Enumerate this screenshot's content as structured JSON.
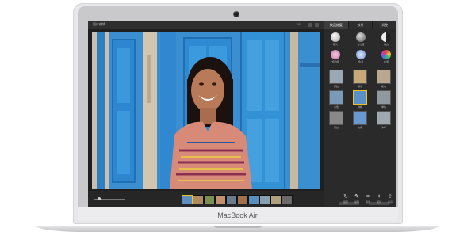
{
  "device": {
    "brand_label": "MacBook Air"
  },
  "app": {
    "window_title": "照片编辑",
    "photo_counter": "1/8",
    "panel_tabs": [
      {
        "label": "快速修复",
        "active": true
      },
      {
        "label": "效果",
        "active": false
      },
      {
        "label": "调整",
        "active": false
      }
    ]
  },
  "adjustments": [
    {
      "label": "曝光",
      "icon": "exposure-icon",
      "color": "#e5e5e5"
    },
    {
      "label": "对比度",
      "icon": "contrast-icon",
      "color": "#9a9a9a"
    },
    {
      "label": "黑白",
      "icon": "bw-icon",
      "color": "#333333"
    },
    {
      "label": "饱和度",
      "icon": "saturation-icon",
      "color": "#c06aa0"
    },
    {
      "label": "色温",
      "icon": "temperature-icon",
      "color": "#6a8fd0"
    },
    {
      "label": "色调",
      "icon": "tint-icon",
      "color": "#e08a40"
    }
  ],
  "filters": [
    {
      "label": "原始",
      "selected": false
    },
    {
      "label": "褪色",
      "selected": false
    },
    {
      "label": "暖色",
      "selected": false
    },
    {
      "label": "冷色",
      "selected": false
    },
    {
      "label": "鲜艳",
      "selected": true
    },
    {
      "label": "单色",
      "selected": false
    },
    {
      "label": "黑白",
      "selected": false
    },
    {
      "label": "淡色",
      "selected": false
    },
    {
      "label": "冲印",
      "selected": false
    }
  ],
  "tools": [
    {
      "label": "旋转",
      "icon": "rotate-icon",
      "glyph": "↻",
      "active": false
    },
    {
      "label": "裁剪",
      "icon": "crop-icon",
      "glyph": "⌗",
      "active": false
    },
    {
      "label": "编辑",
      "icon": "brush-icon",
      "glyph": "✎",
      "active": true
    },
    {
      "label": "美化",
      "icon": "wand-icon",
      "glyph": "✦",
      "active": false
    },
    {
      "label": "共享",
      "icon": "share-icon",
      "glyph": "⇪",
      "active": false
    }
  ],
  "filmstrip": {
    "thumbnails": [
      {
        "selected": true,
        "color": "#5a8fc0"
      },
      {
        "selected": false,
        "color": "#b08a60"
      },
      {
        "selected": false,
        "color": "#7a9050"
      },
      {
        "selected": false,
        "color": "#c09070"
      },
      {
        "selected": false,
        "color": "#6a7a90"
      },
      {
        "selected": false,
        "color": "#a07050"
      },
      {
        "selected": false,
        "color": "#5a8fc0"
      },
      {
        "selected": false,
        "color": "#8aa0b0"
      },
      {
        "selected": false,
        "color": "#b0a080"
      },
      {
        "selected": false,
        "color": "#6a6a6a"
      }
    ]
  },
  "colors": {
    "app_background": "#1f1f1f",
    "panel_background": "#2a2a2a",
    "door_blue": "#3a8fd0",
    "selection": "#f0c020"
  }
}
